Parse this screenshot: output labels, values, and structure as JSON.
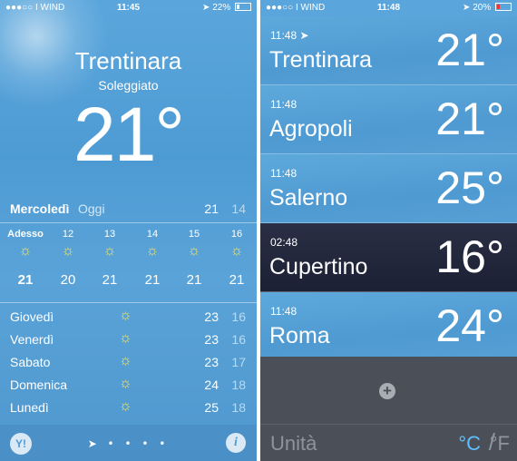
{
  "left": {
    "status": {
      "carrier": "●●●○○ I WIND",
      "time": "11:45",
      "battery": "22%"
    },
    "city": "Trentinara",
    "condition": "Soleggiato",
    "temperature": "21°",
    "today": {
      "day": "Mercoledì",
      "label": "Oggi",
      "high": "21",
      "low": "14"
    },
    "hourly": [
      {
        "label": "Adesso",
        "temp": "21",
        "icon": "sun-icon"
      },
      {
        "label": "12",
        "temp": "20",
        "icon": "sun-icon"
      },
      {
        "label": "13",
        "temp": "21",
        "icon": "sun-icon"
      },
      {
        "label": "14",
        "temp": "21",
        "icon": "sun-icon"
      },
      {
        "label": "15",
        "temp": "21",
        "icon": "sun-icon"
      },
      {
        "label": "16",
        "temp": "21",
        "icon": "sun-icon"
      }
    ],
    "daily": [
      {
        "day": "Giovedì",
        "high": "23",
        "low": "16",
        "icon": "sun-icon"
      },
      {
        "day": "Venerdì",
        "high": "23",
        "low": "16",
        "icon": "sun-icon"
      },
      {
        "day": "Sabato",
        "high": "23",
        "low": "17",
        "icon": "sun-icon"
      },
      {
        "day": "Domenica",
        "high": "24",
        "low": "18",
        "icon": "sun-icon"
      },
      {
        "day": "Lunedì",
        "high": "25",
        "low": "18",
        "icon": "sun-icon"
      }
    ],
    "yahoo": "Y!",
    "info": "i"
  },
  "right": {
    "status": {
      "carrier": "●●●○○ I WIND",
      "time": "11:48",
      "battery": "20%"
    },
    "cities": [
      {
        "time": "11:48",
        "name": "Trentinara",
        "temp": "21°"
      },
      {
        "time": "11:48",
        "name": "Agropoli",
        "temp": "21°"
      },
      {
        "time": "11:48",
        "name": "Salerno",
        "temp": "25°"
      },
      {
        "time": "02:48",
        "name": "Cupertino",
        "temp": "16°"
      },
      {
        "time": "11:48",
        "name": "Roma",
        "temp": "24°"
      }
    ],
    "add": "+",
    "units": {
      "label": "Unità",
      "celsius": "°C",
      "sep": "/",
      "fahrenheit": "°F"
    }
  },
  "colors": {
    "sky": "#4e9bd4",
    "night": "#1c2034",
    "panel": "#4b5058",
    "accent": "#5ec0ff",
    "sun": "#f3e36a"
  }
}
